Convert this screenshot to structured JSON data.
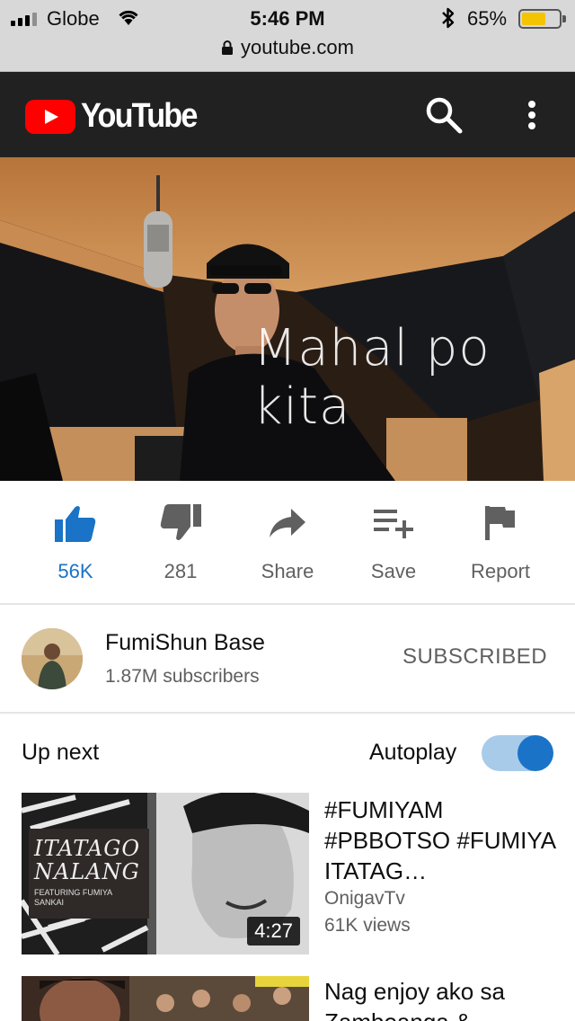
{
  "status_bar": {
    "carrier": "Globe",
    "time": "5:46 PM",
    "battery_percent": "65%",
    "battery_level": 0.65
  },
  "browser": {
    "url": "youtube.com"
  },
  "header": {
    "logo_text": "YouTube"
  },
  "video": {
    "overlay_text": "Mahal po kita"
  },
  "actions": {
    "like": "56K",
    "dislike": "281",
    "share": "Share",
    "save": "Save",
    "report": "Report"
  },
  "channel": {
    "name": "FumiShun Base",
    "subscribers": "1.87M subscribers",
    "subscribe_state": "SUBSCRIBED"
  },
  "up_next": {
    "label": "Up next",
    "autoplay_label": "Autoplay",
    "autoplay_on": true,
    "items": [
      {
        "title": "#FUMIYAM #PBBOTSO #FUMIYA ITATAG…",
        "channel": "OnigavTv",
        "views": "61K views",
        "duration": "4:27",
        "thumb_text_1": "ITATAGO",
        "thumb_text_2": "NALANG",
        "thumb_text_3": "FEATURING FUMIYA",
        "thumb_text_4": "SANKAI"
      },
      {
        "title": "Nag enjoy ako sa Zamboanga &"
      }
    ]
  },
  "colors": {
    "accent": "#1a73c6",
    "header_bg": "#212121",
    "brand_red": "#ff0000"
  }
}
